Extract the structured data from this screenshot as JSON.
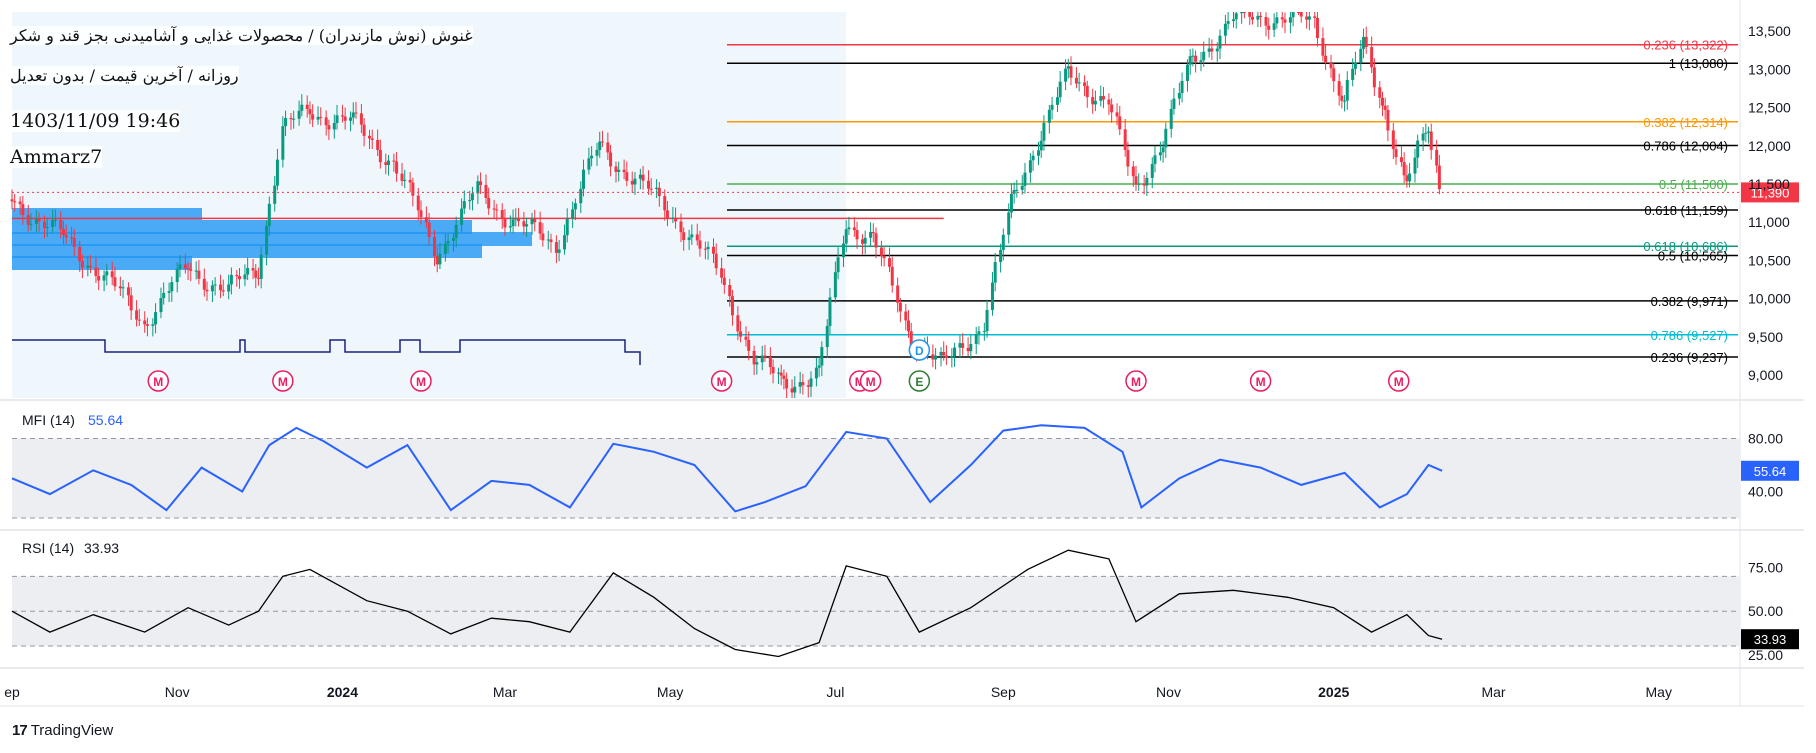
{
  "header": {
    "title": "غنوش (نوش مازندران) / محصولات غذایی و آشامیدنی بجز قند و شکر",
    "subtitle": "روزانه / آخرین قیمت / بدون تعدیل",
    "datetime": "1403/11/09 19:46",
    "author": "Ammarz7"
  },
  "branding": {
    "name": "TradingView"
  },
  "colors": {
    "up": "#089981",
    "down": "#f23645",
    "mfi": "#2962ff",
    "rsi": "#000000",
    "fib_red": "#f23645",
    "fib_orange": "#ff9800",
    "fib_green": "#4caf50",
    "fib_teal": "#089981",
    "fib_cyan": "#00bcd4",
    "volume_profile": "#2196f3",
    "price_tag": "#f23645"
  },
  "chart_data": [
    {
      "type": "candlestick",
      "pane": "price",
      "x_range": [
        "2023-09-01",
        "2025-05-31"
      ],
      "x_tick_labels": [
        "ep",
        "Nov",
        "2024",
        "Mar",
        "May",
        "Jul",
        "Sep",
        "Nov",
        "2025",
        "Mar",
        "May"
      ],
      "x_tick_dates": [
        "2023-09-01",
        "2023-11-01",
        "2024-01-01",
        "2024-03-01",
        "2024-05-01",
        "2024-07-01",
        "2024-09-01",
        "2024-11-01",
        "2025-01-01",
        "2025-03-01",
        "2025-05-01"
      ],
      "ylim": [
        8700,
        13750
      ],
      "y_ticks": [
        9000,
        9500,
        10000,
        10500,
        11000,
        11500,
        12000,
        12500,
        13000,
        13500
      ],
      "y_tick_labels": [
        "9,000",
        "9,500",
        "10,000",
        "10,500",
        "11,000",
        "11,500",
        "12,000",
        "12,500",
        "13,000",
        "13,500"
      ],
      "last_price": 11390,
      "last_price_label": "11,390",
      "price_path": [
        [
          "2023-09-01",
          11300
        ],
        [
          "2023-09-20",
          10800
        ],
        [
          "2023-10-05",
          10300
        ],
        [
          "2023-10-20",
          9700
        ],
        [
          "2023-11-05",
          10400
        ],
        [
          "2023-11-20",
          10100
        ],
        [
          "2023-12-01",
          10400
        ],
        [
          "2023-12-10",
          12200
        ],
        [
          "2023-12-20",
          12450
        ],
        [
          "2024-01-05",
          12300
        ],
        [
          "2024-01-20",
          11800
        ],
        [
          "2024-02-05",
          10600
        ],
        [
          "2024-02-20",
          11400
        ],
        [
          "2024-03-05",
          11000
        ],
        [
          "2024-03-20",
          10700
        ],
        [
          "2024-04-05",
          12000
        ],
        [
          "2024-04-20",
          11500
        ],
        [
          "2024-05-05",
          11000
        ],
        [
          "2024-05-20",
          10300
        ],
        [
          "2024-06-01",
          9200
        ],
        [
          "2024-06-12",
          8900
        ],
        [
          "2024-06-25",
          9000
        ],
        [
          "2024-07-05",
          11000
        ],
        [
          "2024-07-15",
          10800
        ],
        [
          "2024-07-28",
          9600
        ],
        [
          "2024-08-10",
          9100
        ],
        [
          "2024-08-25",
          9700
        ],
        [
          "2024-09-05",
          11300
        ],
        [
          "2024-09-15",
          12200
        ],
        [
          "2024-09-25",
          12900
        ],
        [
          "2024-10-10",
          12600
        ],
        [
          "2024-10-20",
          11400
        ],
        [
          "2024-10-30",
          12100
        ],
        [
          "2024-11-10",
          13100
        ],
        [
          "2024-11-25",
          13650
        ],
        [
          "2024-12-10",
          13700
        ],
        [
          "2024-12-25",
          13600
        ],
        [
          "2025-01-05",
          12600
        ],
        [
          "2025-01-12",
          13300
        ],
        [
          "2025-01-20",
          12500
        ],
        [
          "2025-01-28",
          11500
        ],
        [
          "2025-02-05",
          12200
        ],
        [
          "2025-02-10",
          11390
        ]
      ],
      "fib_levels": [
        {
          "label": "0.236 (13,322)",
          "value": 13322,
          "color": "#f23645"
        },
        {
          "label": "1 (13,080)",
          "value": 13080,
          "color": "#000000"
        },
        {
          "label": "0.382 (12,314)",
          "value": 12314,
          "color": "#ff9800"
        },
        {
          "label": "0.786 (12,004)",
          "value": 12004,
          "color": "#000000"
        },
        {
          "label": "0.5 (11,500)",
          "value": 11500,
          "color": "#4caf50"
        },
        {
          "label": "0.618 (11,159)",
          "value": 11159,
          "color": "#000000"
        },
        {
          "label": "0.618 (10,686)",
          "value": 10686,
          "color": "#089981"
        },
        {
          "label": "0.5 (10,565)",
          "value": 10565,
          "color": "#000000"
        },
        {
          "label": "0.382 (9,971)",
          "value": 9971,
          "color": "#000000"
        },
        {
          "label": "0.786 (9,527)",
          "value": 9527,
          "color": "#00bcd4"
        },
        {
          "label": "0.236 (9,237)",
          "value": 9237,
          "color": "#000000"
        }
      ],
      "horizontal_ray": {
        "value": 11050,
        "from": "2023-09-01",
        "to": "2024-08-10",
        "color": "#f23645"
      },
      "event_markers": [
        {
          "label": "M",
          "date": "2023-10-25"
        },
        {
          "label": "M",
          "date": "2023-12-10"
        },
        {
          "label": "M",
          "date": "2024-01-30"
        },
        {
          "label": "M",
          "date": "2024-05-20"
        },
        {
          "label": "M",
          "date": "2024-07-10"
        },
        {
          "label": "M",
          "date": "2024-07-14"
        },
        {
          "label": "M",
          "date": "2024-10-20"
        },
        {
          "label": "M",
          "date": "2024-12-05"
        },
        {
          "label": "M",
          "date": "2025-01-25"
        },
        {
          "label": "D",
          "date": "2024-08-01"
        },
        {
          "label": "E",
          "date": "2024-08-01"
        }
      ]
    },
    {
      "type": "line",
      "pane": "mfi",
      "name": "MFI (14)",
      "last_value": 55.64,
      "last_value_label": "55.64",
      "ylim": [
        20,
        100
      ],
      "bands": [
        80,
        20
      ],
      "y_tick_labels": [
        "80.00",
        "40.00"
      ],
      "y_ticks": [
        80,
        40
      ],
      "points": [
        [
          "2023-09-01",
          50
        ],
        [
          "2023-09-15",
          38
        ],
        [
          "2023-10-01",
          56
        ],
        [
          "2023-10-15",
          45
        ],
        [
          "2023-10-28",
          26
        ],
        [
          "2023-11-10",
          58
        ],
        [
          "2023-11-25",
          40
        ],
        [
          "2023-12-05",
          75
        ],
        [
          "2023-12-15",
          88
        ],
        [
          "2023-12-25",
          78
        ],
        [
          "2024-01-10",
          58
        ],
        [
          "2024-01-25",
          75
        ],
        [
          "2024-02-10",
          26
        ],
        [
          "2024-02-25",
          48
        ],
        [
          "2024-03-10",
          45
        ],
        [
          "2024-03-25",
          28
        ],
        [
          "2024-04-10",
          76
        ],
        [
          "2024-04-25",
          70
        ],
        [
          "2024-05-10",
          60
        ],
        [
          "2024-05-25",
          25
        ],
        [
          "2024-06-05",
          32
        ],
        [
          "2024-06-20",
          44
        ],
        [
          "2024-07-05",
          85
        ],
        [
          "2024-07-20",
          80
        ],
        [
          "2024-08-05",
          32
        ],
        [
          "2024-08-20",
          60
        ],
        [
          "2024-09-01",
          86
        ],
        [
          "2024-09-15",
          90
        ],
        [
          "2024-10-01",
          88
        ],
        [
          "2024-10-15",
          70
        ],
        [
          "2024-10-22",
          28
        ],
        [
          "2024-11-05",
          50
        ],
        [
          "2024-11-20",
          64
        ],
        [
          "2024-12-05",
          58
        ],
        [
          "2024-12-20",
          45
        ],
        [
          "2025-01-05",
          54
        ],
        [
          "2025-01-18",
          28
        ],
        [
          "2025-01-28",
          38
        ],
        [
          "2025-02-05",
          60
        ],
        [
          "2025-02-10",
          55.64
        ]
      ]
    },
    {
      "type": "line",
      "pane": "rsi",
      "name": "RSI (14)",
      "last_value": 33.93,
      "last_value_label": "33.93",
      "ylim": [
        22,
        92
      ],
      "bands": [
        70,
        50,
        30
      ],
      "y_ticks": [
        75,
        50,
        25
      ],
      "y_tick_labels": [
        "75.00",
        "50.00",
        "25.00"
      ],
      "points": [
        [
          "2023-09-01",
          50
        ],
        [
          "2023-09-15",
          38
        ],
        [
          "2023-10-01",
          48
        ],
        [
          "2023-10-20",
          38
        ],
        [
          "2023-11-05",
          52
        ],
        [
          "2023-11-20",
          42
        ],
        [
          "2023-12-01",
          50
        ],
        [
          "2023-12-10",
          70
        ],
        [
          "2023-12-20",
          74
        ],
        [
          "2024-01-10",
          56
        ],
        [
          "2024-01-25",
          50
        ],
        [
          "2024-02-10",
          37
        ],
        [
          "2024-02-25",
          46
        ],
        [
          "2024-03-10",
          44
        ],
        [
          "2024-03-25",
          38
        ],
        [
          "2024-04-10",
          72
        ],
        [
          "2024-04-25",
          58
        ],
        [
          "2024-05-10",
          40
        ],
        [
          "2024-05-25",
          28
        ],
        [
          "2024-06-10",
          24
        ],
        [
          "2024-06-25",
          32
        ],
        [
          "2024-07-05",
          76
        ],
        [
          "2024-07-20",
          70
        ],
        [
          "2024-08-01",
          38
        ],
        [
          "2024-08-20",
          52
        ],
        [
          "2024-09-10",
          74
        ],
        [
          "2024-09-25",
          85
        ],
        [
          "2024-10-10",
          80
        ],
        [
          "2024-10-20",
          44
        ],
        [
          "2024-11-05",
          60
        ],
        [
          "2024-11-25",
          62
        ],
        [
          "2024-12-15",
          58
        ],
        [
          "2025-01-01",
          52
        ],
        [
          "2025-01-15",
          38
        ],
        [
          "2025-01-28",
          48
        ],
        [
          "2025-02-05",
          36
        ],
        [
          "2025-02-10",
          33.93
        ]
      ]
    }
  ]
}
